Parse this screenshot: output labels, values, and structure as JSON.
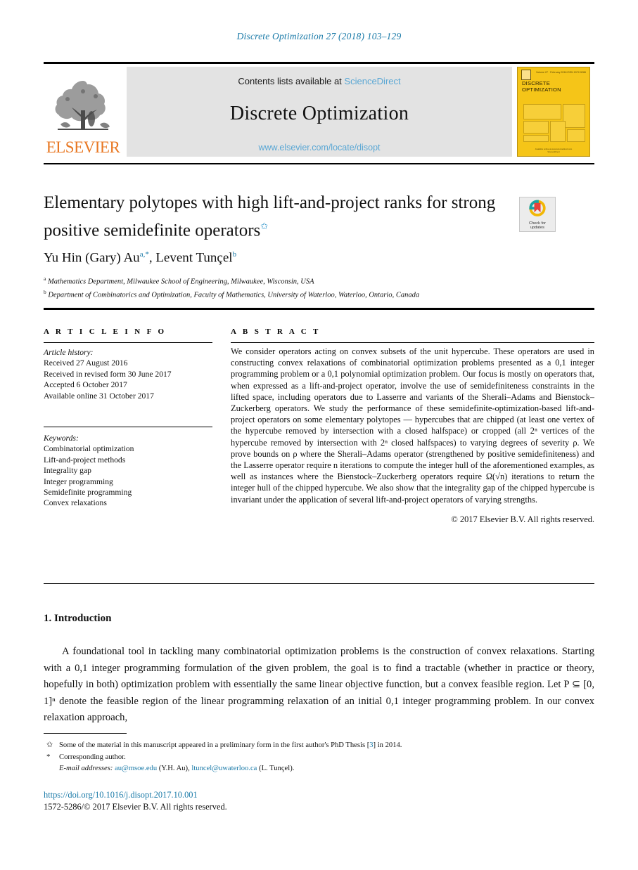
{
  "running_head": "Discrete Optimization 27 (2018) 103–129",
  "masthead": {
    "publisher_logo_label": "ELSEVIER",
    "contents_prefix": "Contents lists available at",
    "sciencedirect_link": "ScienceDirect",
    "journal_title": "Discrete Optimization",
    "journal_url": "www.elsevier.com/locate/disopt",
    "cover": {
      "volume_line": "Volume 27 · February 2018",
      "issn_line": "ISSN 1572-5286",
      "elsevier_mark": "ELSEVIER",
      "title_line1": "DISCRETE",
      "title_line2": "OPTIMIZATION",
      "footer_line1": "Available online at www.sciencedirect.com",
      "footer_line2": "ScienceDirect"
    }
  },
  "article": {
    "title": "Elementary polytopes with high lift-and-project ranks for strong positive semidefinite operators",
    "title_footnote_mark": "✩",
    "crossmark_line1": "Check for",
    "crossmark_line2": "updates",
    "authors": "Yu Hin (Gary) Au",
    "author1_sup": "a,*",
    "authors2": ", Levent Tunçel",
    "author2_sup": "b",
    "affiliations": [
      {
        "mark": "a",
        "text": "Mathematics Department, Milwaukee School of Engineering, Milwaukee, Wisconsin, USA"
      },
      {
        "mark": "b",
        "text": "Department of Combinatorics and Optimization, Faculty of Mathematics, University of Waterloo, Waterloo, Ontario, Canada"
      }
    ]
  },
  "info": {
    "heading": "A R T I C L E   I N F O",
    "history_label": "Article history:",
    "history": [
      "Received 27 August 2016",
      "Received in revised form 30 June 2017",
      "Accepted 6 October 2017",
      "Available online 31 October 2017"
    ],
    "keywords_label": "Keywords:",
    "keywords": [
      "Combinatorial optimization",
      "Lift-and-project methods",
      "Integrality gap",
      "Integer programming",
      "Semidefinite programming",
      "Convex relaxations"
    ]
  },
  "abstract": {
    "heading": "A B S T R A C T",
    "text": "We consider operators acting on convex subsets of the unit hypercube. These operators are used in constructing convex relaxations of combinatorial optimization problems presented as a 0,1 integer programming problem or a 0,1 polynomial optimization problem. Our focus is mostly on operators that, when expressed as a lift-and-project operator, involve the use of semidefiniteness constraints in the lifted space, including operators due to Lasserre and variants of the Sherali–Adams and Bienstock–Zuckerberg operators. We study the performance of these semidefinite-optimization-based lift-and-project operators on some elementary polytopes — hypercubes that are chipped (at least one vertex of the hypercube removed by intersection with a closed halfspace) or cropped (all 2ⁿ vertices of the hypercube removed by intersection with 2ⁿ closed halfspaces) to varying degrees of severity ρ. We prove bounds on ρ where the Sherali–Adams operator (strengthened by positive semidefiniteness) and the Lasserre operator require n iterations to compute the integer hull of the aforementioned examples, as well as instances where the Bienstock–Zuckerberg operators require Ω(√n) iterations to return the integer hull of the chipped hypercube. We also show that the integrality gap of the chipped hypercube is invariant under the application of several lift-and-project operators of varying strengths.",
    "copyright": "© 2017 Elsevier B.V. All rights reserved."
  },
  "body": {
    "section_number_title": "1. Introduction",
    "paragraph": "A foundational tool in tackling many combinatorial optimization problems is the construction of convex relaxations. Starting with a 0,1 integer programming formulation of the given problem, the goal is to find a tractable (whether in practice or theory, hopefully in both) optimization problem with essentially the same linear objective function, but a convex feasible region. Let P ⊆ [0, 1]ⁿ denote the feasible region of the linear programming relaxation of an initial 0,1 integer programming problem. In our convex relaxation approach,"
  },
  "footnotes": {
    "star_mark": "✩",
    "star_text_before_ref": "Some of the material in this manuscript appeared in a preliminary form in the first author's PhD Thesis [",
    "star_ref": "3",
    "star_text_after_ref": "] in 2014.",
    "asterisk_mark": "*",
    "corresponding": "Corresponding author.",
    "email_label": "E-mail addresses:",
    "email1": "au@msoe.edu",
    "email1_owner": "(Y.H. Au),",
    "email2": "ltuncel@uwaterloo.ca",
    "email2_owner": "(L. Tunçel)."
  },
  "footer": {
    "doi": "https://doi.org/10.1016/j.disopt.2017.10.001",
    "issn_copyright": "1572-5286/© 2017 Elsevier B.V. All rights reserved."
  },
  "colors": {
    "link_blue": "#1a7aa8",
    "sciencedirect_blue": "#5aa7d4",
    "elsevier_orange": "#e87722",
    "cover_yellow": "#f5c518",
    "banner_gray": "#e3e3e3"
  }
}
